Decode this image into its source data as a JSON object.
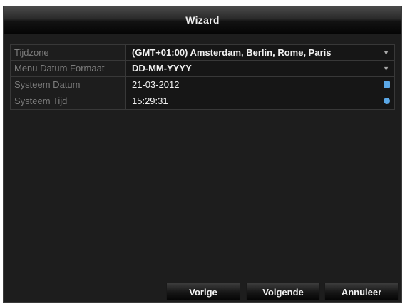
{
  "window": {
    "title": "Wizard"
  },
  "fields": [
    {
      "label": "Tijdzone",
      "value": "(GMT+01:00) Amsterdam, Berlin, Rome, Paris",
      "control": "dropdown"
    },
    {
      "label": "Menu Datum Formaat",
      "value": "DD-MM-YYYY",
      "control": "dropdown"
    },
    {
      "label": "Systeem Datum",
      "value": "21-03-2012",
      "control": "date-picker"
    },
    {
      "label": "Systeem Tijd",
      "value": "15:29:31",
      "control": "time-picker"
    }
  ],
  "buttons": {
    "prev": "Vorige",
    "next": "Volgende",
    "cancel": "Annuleer"
  },
  "icons": {
    "dropdown": "chevron-down-icon",
    "date": "calendar-icon",
    "time": "clock-icon"
  },
  "colors": {
    "window_bg": "#1d1d1d",
    "label_text": "#7c7c7c",
    "value_text": "#f2f2f2",
    "accent_icon": "#5aa7e6"
  }
}
